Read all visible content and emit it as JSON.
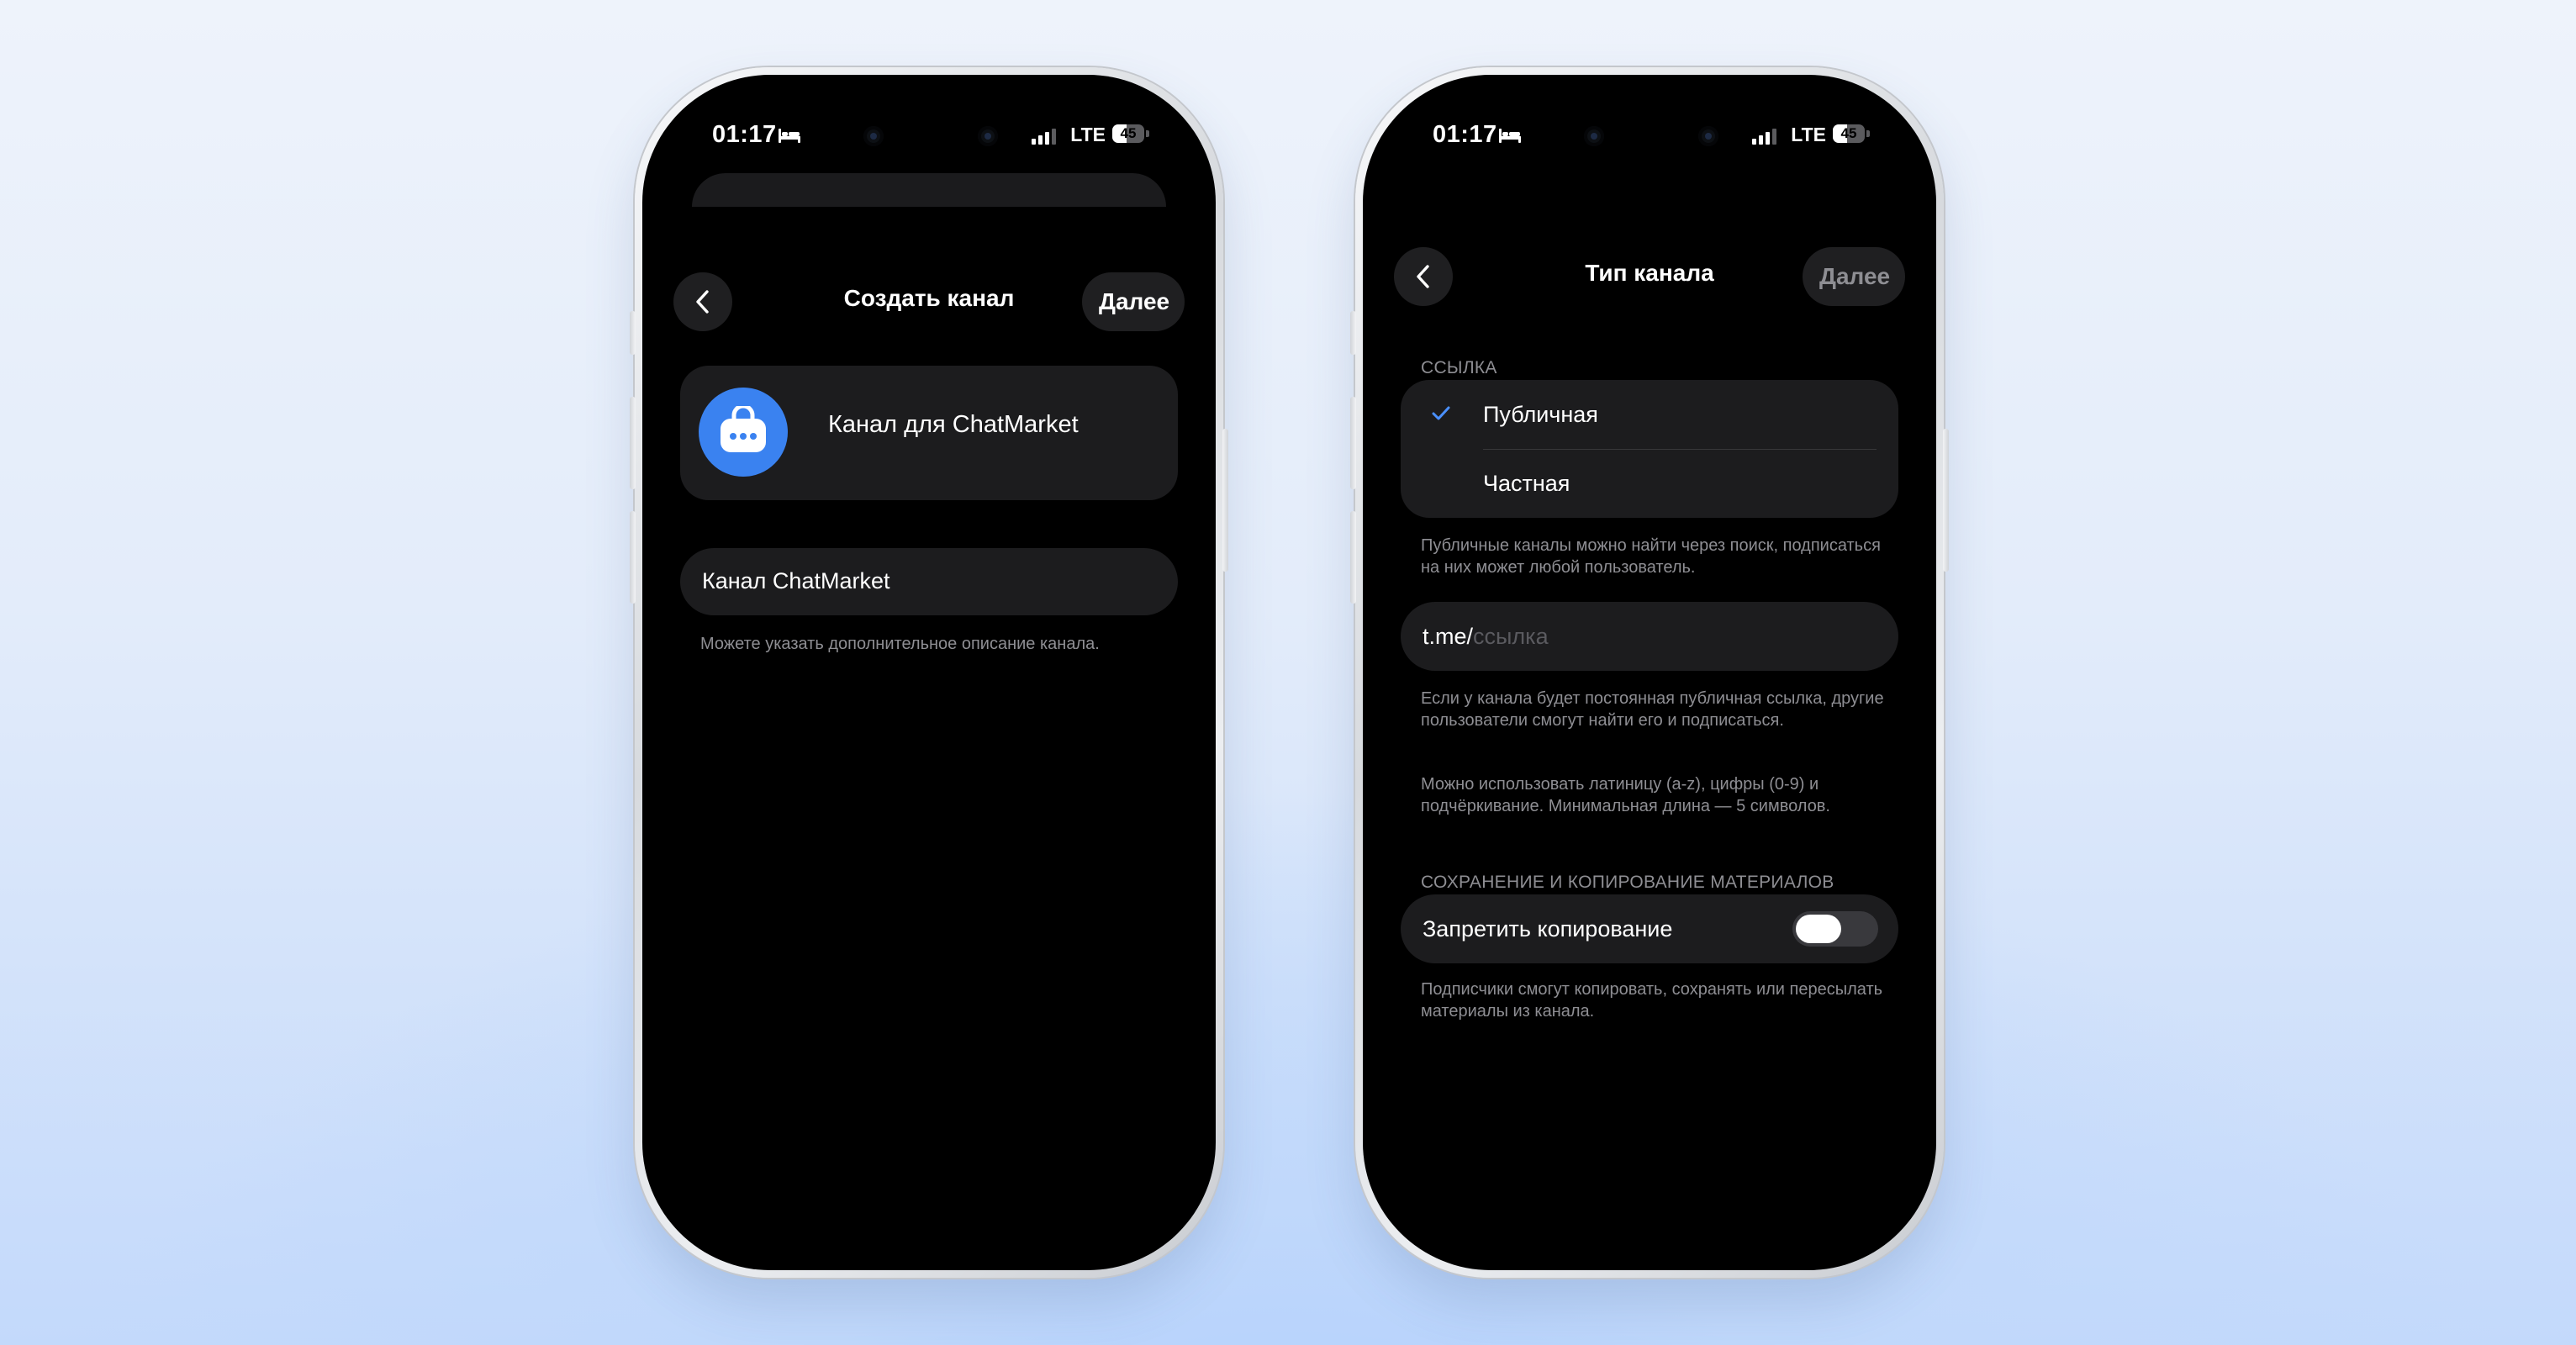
{
  "status_bar": {
    "time": "01:17",
    "network": "LTE",
    "battery": "45",
    "battery_level": 0.45
  },
  "create_channel_screen": {
    "nav": {
      "title": "Создать канал",
      "next_label": "Далее"
    },
    "channel_name": "Канал для ChatMarket",
    "description_value": "Канал ChatMarket",
    "description_hint": "Можете указать дополнительное описание канала."
  },
  "channel_type_screen": {
    "nav": {
      "title": "Тип канала",
      "next_label": "Далее"
    },
    "link_section": {
      "header": "ССЫЛКА",
      "options": [
        {
          "label": "Публичная",
          "selected": true
        },
        {
          "label": "Частная",
          "selected": false
        }
      ],
      "hint": "Публичные каналы можно найти через поиск, подписаться на них может любой пользователь."
    },
    "link_input": {
      "prefix": "t.me/",
      "placeholder": "ссылка"
    },
    "link_hint_1": "Если у канала будет постоянная публичная ссылка, другие пользователи смогут найти его и подписаться.",
    "link_hint_2": "Можно использовать латиницу (a-z), цифры (0-9) и подчёркивание. Минимальная длина — 5 символов.",
    "content_section": {
      "header": "СОХРАНЕНИЕ И КОПИРОВАНИЕ МАТЕРИАЛОВ",
      "toggle_label": "Запретить копирование",
      "toggle_on": false,
      "hint": "Подписчики смогут копировать, сохранять или пересылать материалы из канала."
    }
  },
  "colors": {
    "accent": "#3a82f0",
    "checkmark": "#4a90ff",
    "card_bg": "#1c1c1e",
    "hint_text": "#8e8e93",
    "disabled_text": "#8e8e93"
  }
}
